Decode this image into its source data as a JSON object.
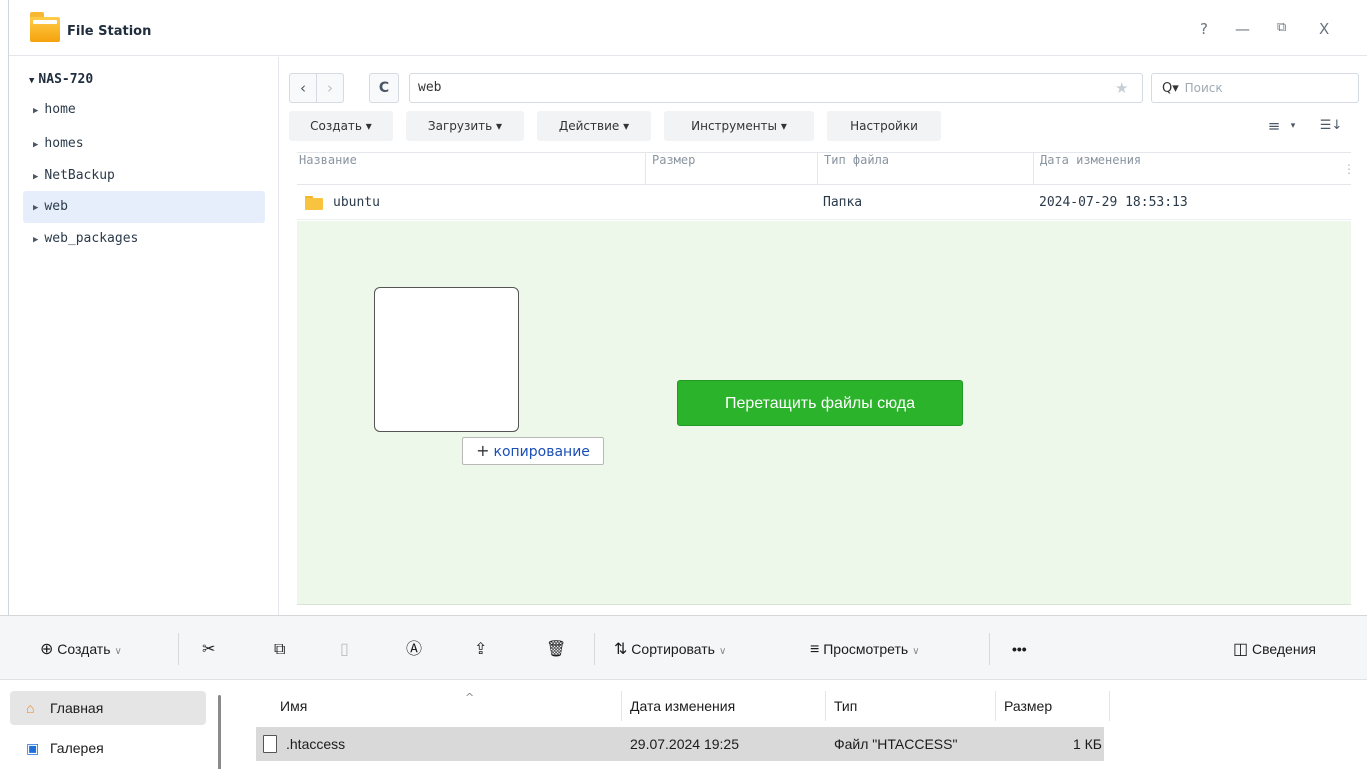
{
  "file_station": {
    "title": "File Station",
    "window_controls": {
      "help": "?",
      "minimize": "—",
      "restore": "⧉",
      "close": "X"
    },
    "tree": {
      "root": "NAS-720",
      "items": [
        {
          "label": "home",
          "selected": false
        },
        {
          "label": "homes",
          "selected": false
        },
        {
          "label": "NetBackup",
          "selected": false
        },
        {
          "label": "web",
          "selected": true
        },
        {
          "label": "web_packages",
          "selected": false
        }
      ]
    },
    "path": "web",
    "search_placeholder": "Поиск",
    "toolbar": {
      "create": "Создать ▾",
      "upload": "Загрузить ▾",
      "action": "Действие ▾",
      "tools": "Инструменты ▾",
      "settings": "Настройки"
    },
    "columns": [
      "Название",
      "Размер",
      "Тип файла",
      "Дата изменения"
    ],
    "rows": [
      {
        "name": "ubuntu",
        "size": "",
        "type": "Папка",
        "modified": "2024-07-29 18:53:13"
      }
    ],
    "drop_button": "Перетащить файлы сюда",
    "drag_label": "копирование"
  },
  "explorer": {
    "commands": {
      "create": "Создать",
      "sort": "Сортировать",
      "view": "Просмотреть",
      "more": "•••",
      "details": "Сведения"
    },
    "nav": [
      {
        "label": "Главная",
        "icon": "home-icon",
        "active": true
      },
      {
        "label": "Галерея",
        "icon": "gallery-icon",
        "active": false
      }
    ],
    "columns": [
      "Имя",
      "Дата изменения",
      "Тип",
      "Размер"
    ],
    "rows": [
      {
        "name": ".htaccess",
        "modified": "29.07.2024 19:25",
        "type": "Файл \"HTACCESS\"",
        "size": "1 КБ"
      }
    ]
  },
  "colors": {
    "drop_button": "#2bb32b",
    "drop_area": "#eef8ea",
    "tree_selected": "#e6eefb"
  }
}
